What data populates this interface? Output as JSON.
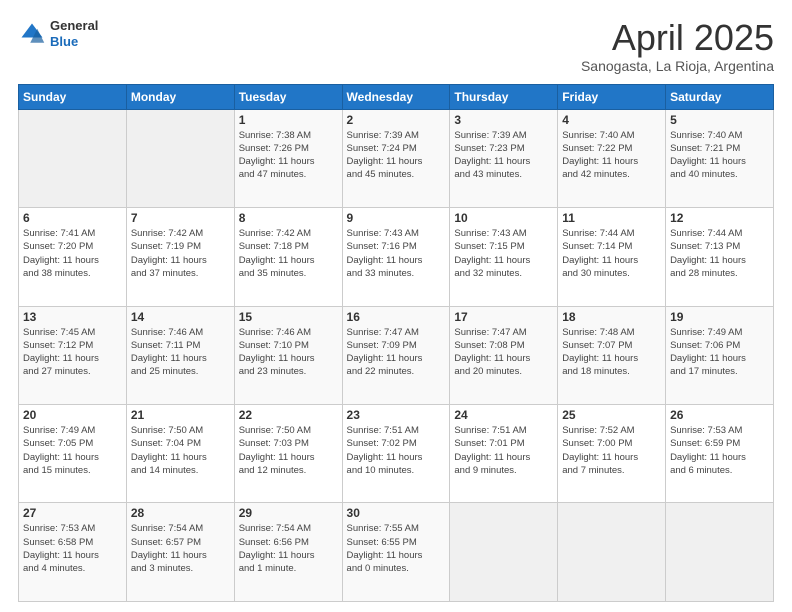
{
  "header": {
    "logo_general": "General",
    "logo_blue": "Blue",
    "title": "April 2025",
    "subtitle": "Sanogasta, La Rioja, Argentina"
  },
  "calendar": {
    "days_of_week": [
      "Sunday",
      "Monday",
      "Tuesday",
      "Wednesday",
      "Thursday",
      "Friday",
      "Saturday"
    ],
    "weeks": [
      [
        {
          "day": "",
          "detail": ""
        },
        {
          "day": "",
          "detail": ""
        },
        {
          "day": "1",
          "detail": "Sunrise: 7:38 AM\nSunset: 7:26 PM\nDaylight: 11 hours\nand 47 minutes."
        },
        {
          "day": "2",
          "detail": "Sunrise: 7:39 AM\nSunset: 7:24 PM\nDaylight: 11 hours\nand 45 minutes."
        },
        {
          "day": "3",
          "detail": "Sunrise: 7:39 AM\nSunset: 7:23 PM\nDaylight: 11 hours\nand 43 minutes."
        },
        {
          "day": "4",
          "detail": "Sunrise: 7:40 AM\nSunset: 7:22 PM\nDaylight: 11 hours\nand 42 minutes."
        },
        {
          "day": "5",
          "detail": "Sunrise: 7:40 AM\nSunset: 7:21 PM\nDaylight: 11 hours\nand 40 minutes."
        }
      ],
      [
        {
          "day": "6",
          "detail": "Sunrise: 7:41 AM\nSunset: 7:20 PM\nDaylight: 11 hours\nand 38 minutes."
        },
        {
          "day": "7",
          "detail": "Sunrise: 7:42 AM\nSunset: 7:19 PM\nDaylight: 11 hours\nand 37 minutes."
        },
        {
          "day": "8",
          "detail": "Sunrise: 7:42 AM\nSunset: 7:18 PM\nDaylight: 11 hours\nand 35 minutes."
        },
        {
          "day": "9",
          "detail": "Sunrise: 7:43 AM\nSunset: 7:16 PM\nDaylight: 11 hours\nand 33 minutes."
        },
        {
          "day": "10",
          "detail": "Sunrise: 7:43 AM\nSunset: 7:15 PM\nDaylight: 11 hours\nand 32 minutes."
        },
        {
          "day": "11",
          "detail": "Sunrise: 7:44 AM\nSunset: 7:14 PM\nDaylight: 11 hours\nand 30 minutes."
        },
        {
          "day": "12",
          "detail": "Sunrise: 7:44 AM\nSunset: 7:13 PM\nDaylight: 11 hours\nand 28 minutes."
        }
      ],
      [
        {
          "day": "13",
          "detail": "Sunrise: 7:45 AM\nSunset: 7:12 PM\nDaylight: 11 hours\nand 27 minutes."
        },
        {
          "day": "14",
          "detail": "Sunrise: 7:46 AM\nSunset: 7:11 PM\nDaylight: 11 hours\nand 25 minutes."
        },
        {
          "day": "15",
          "detail": "Sunrise: 7:46 AM\nSunset: 7:10 PM\nDaylight: 11 hours\nand 23 minutes."
        },
        {
          "day": "16",
          "detail": "Sunrise: 7:47 AM\nSunset: 7:09 PM\nDaylight: 11 hours\nand 22 minutes."
        },
        {
          "day": "17",
          "detail": "Sunrise: 7:47 AM\nSunset: 7:08 PM\nDaylight: 11 hours\nand 20 minutes."
        },
        {
          "day": "18",
          "detail": "Sunrise: 7:48 AM\nSunset: 7:07 PM\nDaylight: 11 hours\nand 18 minutes."
        },
        {
          "day": "19",
          "detail": "Sunrise: 7:49 AM\nSunset: 7:06 PM\nDaylight: 11 hours\nand 17 minutes."
        }
      ],
      [
        {
          "day": "20",
          "detail": "Sunrise: 7:49 AM\nSunset: 7:05 PM\nDaylight: 11 hours\nand 15 minutes."
        },
        {
          "day": "21",
          "detail": "Sunrise: 7:50 AM\nSunset: 7:04 PM\nDaylight: 11 hours\nand 14 minutes."
        },
        {
          "day": "22",
          "detail": "Sunrise: 7:50 AM\nSunset: 7:03 PM\nDaylight: 11 hours\nand 12 minutes."
        },
        {
          "day": "23",
          "detail": "Sunrise: 7:51 AM\nSunset: 7:02 PM\nDaylight: 11 hours\nand 10 minutes."
        },
        {
          "day": "24",
          "detail": "Sunrise: 7:51 AM\nSunset: 7:01 PM\nDaylight: 11 hours\nand 9 minutes."
        },
        {
          "day": "25",
          "detail": "Sunrise: 7:52 AM\nSunset: 7:00 PM\nDaylight: 11 hours\nand 7 minutes."
        },
        {
          "day": "26",
          "detail": "Sunrise: 7:53 AM\nSunset: 6:59 PM\nDaylight: 11 hours\nand 6 minutes."
        }
      ],
      [
        {
          "day": "27",
          "detail": "Sunrise: 7:53 AM\nSunset: 6:58 PM\nDaylight: 11 hours\nand 4 minutes."
        },
        {
          "day": "28",
          "detail": "Sunrise: 7:54 AM\nSunset: 6:57 PM\nDaylight: 11 hours\nand 3 minutes."
        },
        {
          "day": "29",
          "detail": "Sunrise: 7:54 AM\nSunset: 6:56 PM\nDaylight: 11 hours\nand 1 minute."
        },
        {
          "day": "30",
          "detail": "Sunrise: 7:55 AM\nSunset: 6:55 PM\nDaylight: 11 hours\nand 0 minutes."
        },
        {
          "day": "",
          "detail": ""
        },
        {
          "day": "",
          "detail": ""
        },
        {
          "day": "",
          "detail": ""
        }
      ]
    ]
  }
}
